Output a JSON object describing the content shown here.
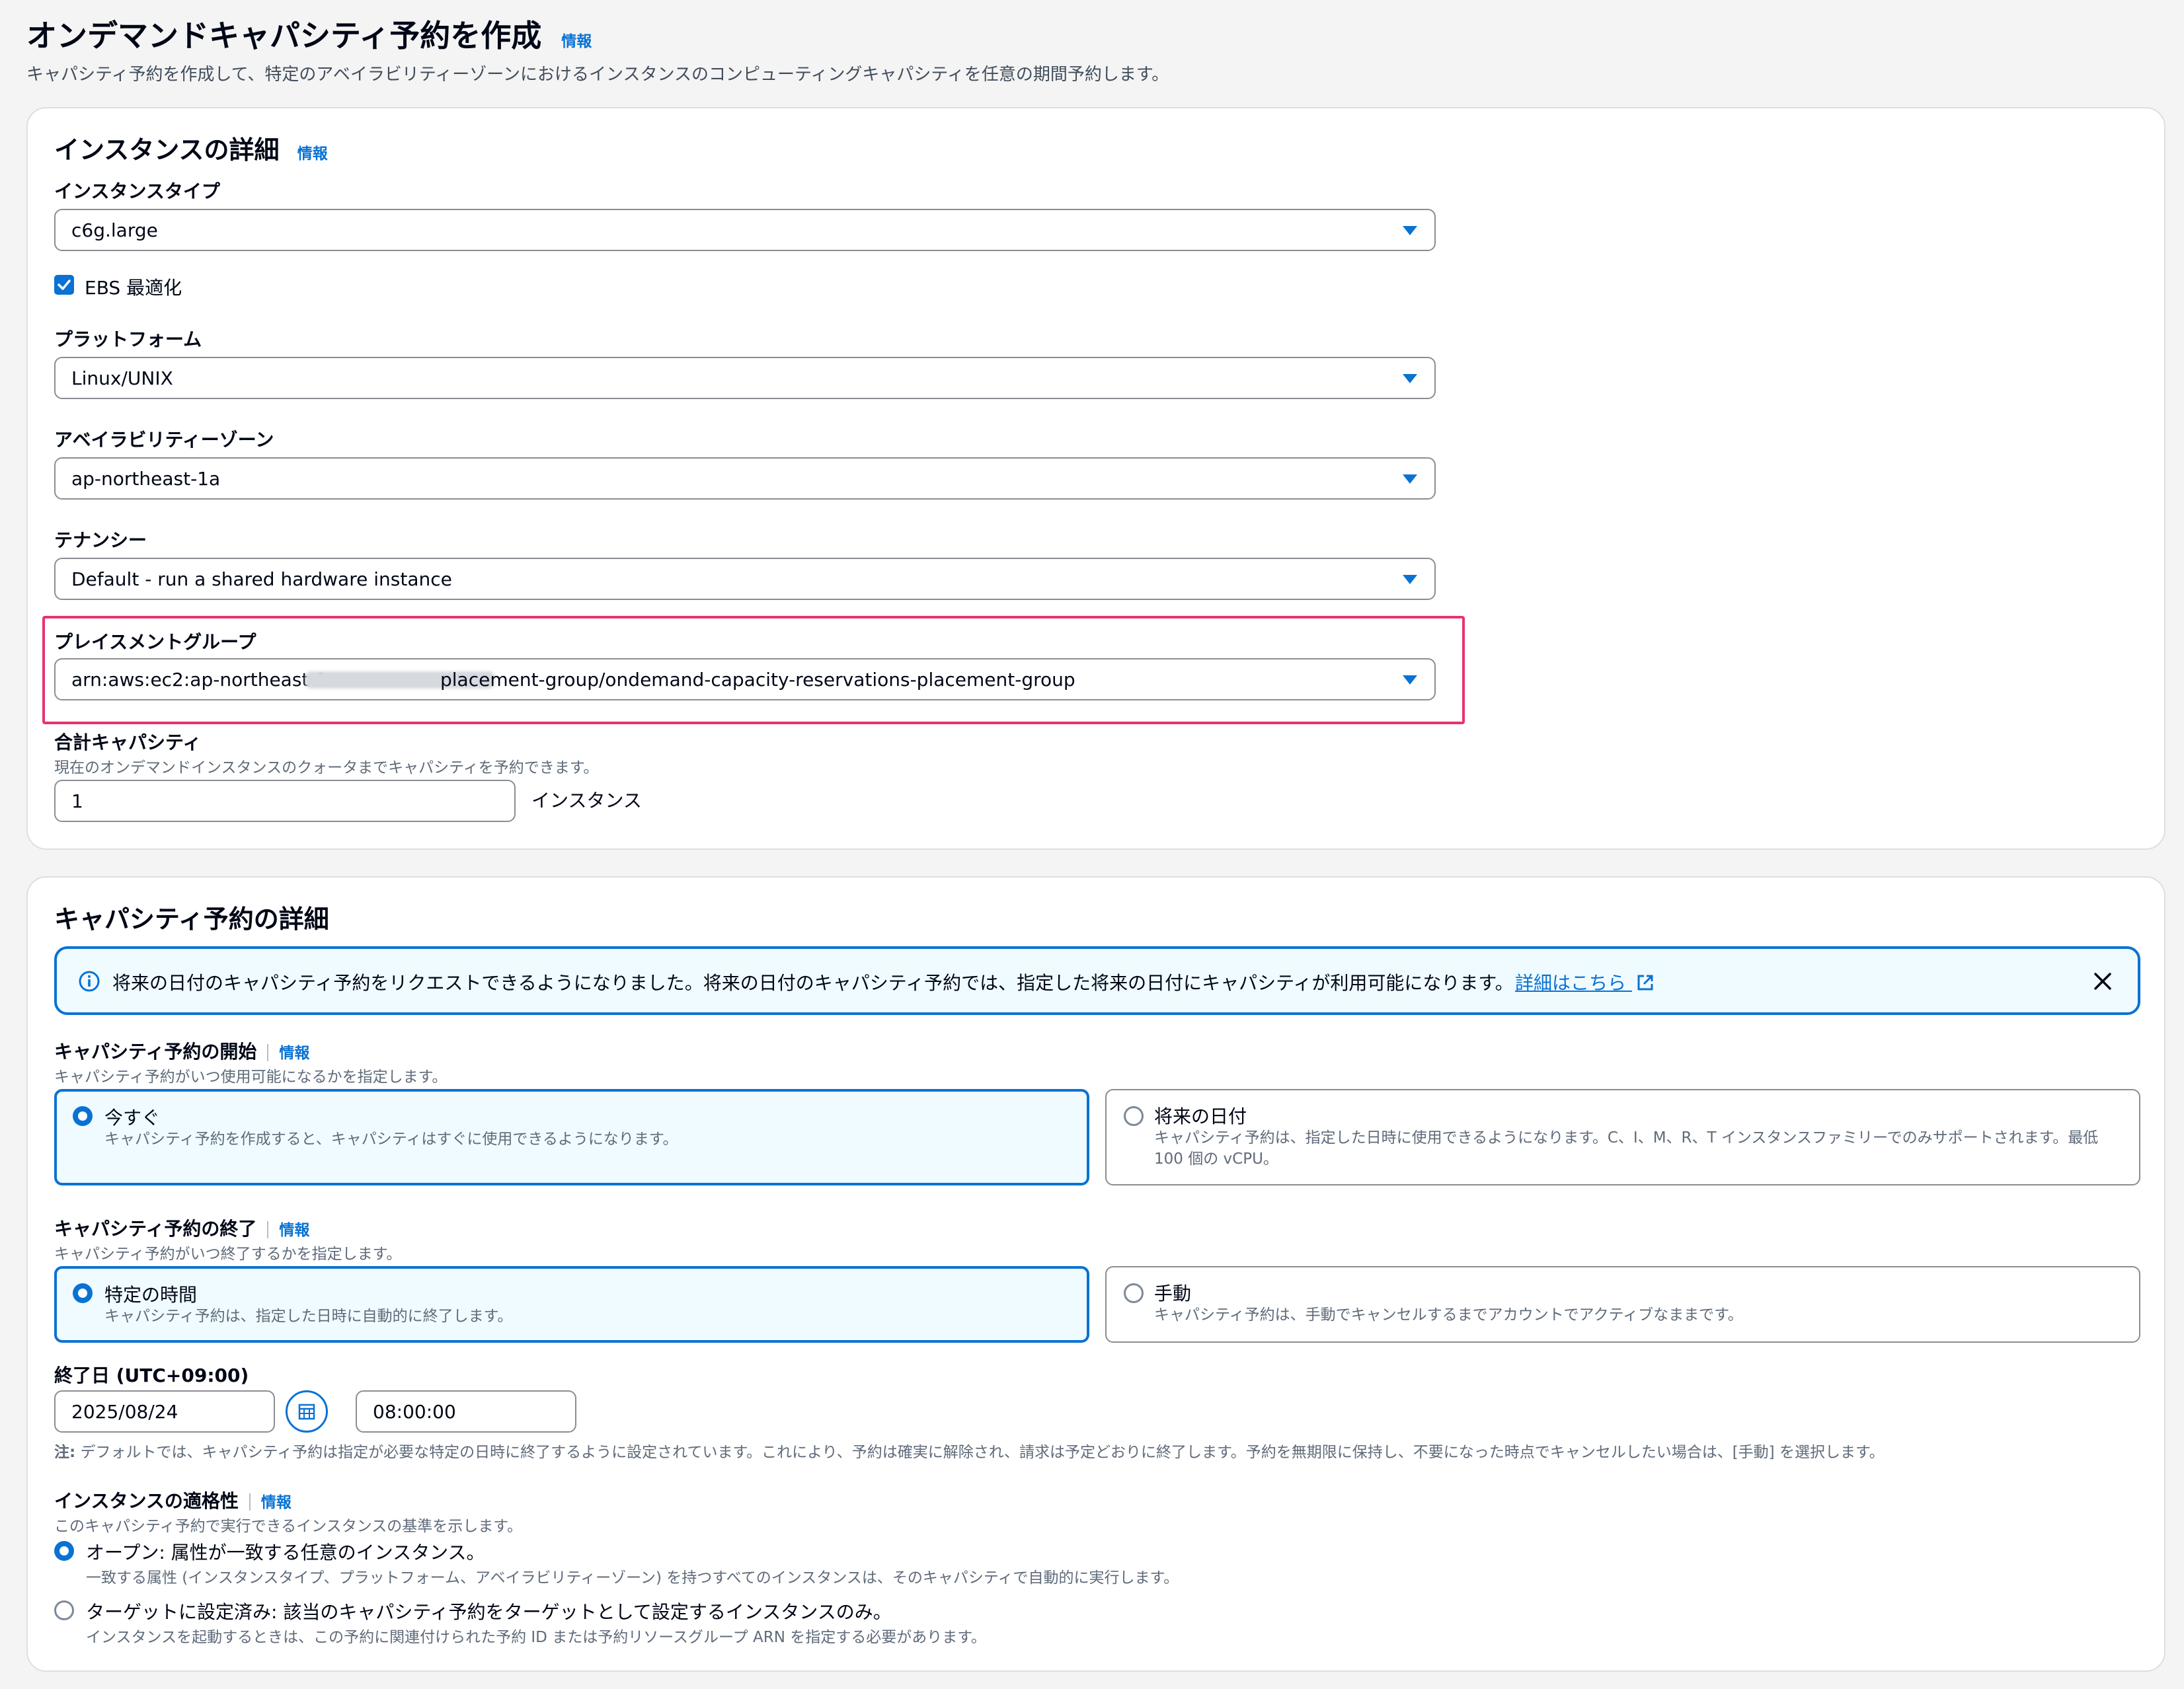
{
  "page": {
    "title": "オンデマンドキャパシティ予約を作成",
    "info": "情報",
    "description": "キャパシティ予約を作成して、特定のアベイラビリティーゾーンにおけるインスタンスのコンピューティングキャパシティを任意の期間予約します。"
  },
  "instance_details": {
    "heading": "インスタンスの詳細",
    "info": "情報",
    "instance_type_label": "インスタンスタイプ",
    "instance_type_value": "c6g.large",
    "ebs_label": "EBS 最適化",
    "ebs_checked": true,
    "platform_label": "プラットフォーム",
    "platform_value": "Linux/UNIX",
    "az_label": "アベイラビリティーゾーン",
    "az_value": "ap-northeast-1a",
    "tenancy_label": "テナンシー",
    "tenancy_value": "Default - run a shared hardware instance",
    "placement_label": "プレイスメントグループ",
    "placement_prefix": "arn:aws:ec2:ap-northeast-1",
    "placement_suffix": "placement-group/ondemand-capacity-reservations-placement-group",
    "capacity_label": "合計キャパシティ",
    "capacity_desc": "現在のオンデマンドインスタンスのクォータまでキャパシティを予約できます。",
    "capacity_value": "1",
    "capacity_unit": "インスタンス"
  },
  "reservation_details": {
    "heading": "キャパシティ予約の詳細",
    "banner_text": "将来の日付のキャパシティ予約をリクエストできるようになりました。将来の日付のキャパシティ予約では、指定した将来の日付にキャパシティが利用可能になります。",
    "banner_link": "詳細はこちら",
    "start_label": "キャパシティ予約の開始",
    "start_info": "情報",
    "start_desc": "キャパシティ予約がいつ使用可能になるかを指定します。",
    "start_now_title": "今すぐ",
    "start_now_desc": "キャパシティ予約を作成すると、キャパシティはすぐに使用できるようになります。",
    "start_future_title": "将来の日付",
    "start_future_desc": "キャパシティ予約は、指定した日時に使用できるようになります。C、I、M、R、T インスタンスファミリーでのみサポートされます。最低 100 個の vCPU。",
    "end_label": "キャパシティ予約の終了",
    "end_info": "情報",
    "end_desc": "キャパシティ予約がいつ終了するかを指定します。",
    "end_specific_title": "特定の時間",
    "end_specific_desc": "キャパシティ予約は、指定した日時に自動的に終了します。",
    "end_manual_title": "手動",
    "end_manual_desc": "キャパシティ予約は、手動でキャンセルするまでアカウントでアクティブなままです。",
    "end_date_label": "終了日 (UTC+09:00)",
    "end_date_value": "2025/08/24",
    "end_time_value": "08:00:00",
    "note_prefix": "注:",
    "note_text": " デフォルトでは、キャパシティ予約は指定が必要な特定の日時に終了するように設定されています。これにより、予約は確実に解除され、請求は予定どおりに終了します。予約を無期限に保持し、不要になった時点でキャンセルしたい場合は、[手動] を選択します。",
    "eligibility_label": "インスタンスの適格性",
    "eligibility_info": "情報",
    "eligibility_desc": "このキャパシティ予約で実行できるインスタンスの基準を示します。",
    "open_title": "オープン: 属性が一致する任意のインスタンス。",
    "open_desc": "一致する属性 (インスタンスタイプ、プラットフォーム、アベイラビリティーゾーン) を持つすべてのインスタンスは、そのキャパシティで自動的に実行します。",
    "targeted_title": "ターゲットに設定済み: 該当のキャパシティ予約をターゲットとして設定するインスタンスのみ。",
    "targeted_desc": "インスタンスを起動するときは、この予約に関連付けられた予約 ID または予約リソースグループ ARN を指定する必要があります。"
  },
  "colors": {
    "accent": "#0972d3",
    "highlight": "#e8336e",
    "banner_bg": "#f0fbff"
  }
}
